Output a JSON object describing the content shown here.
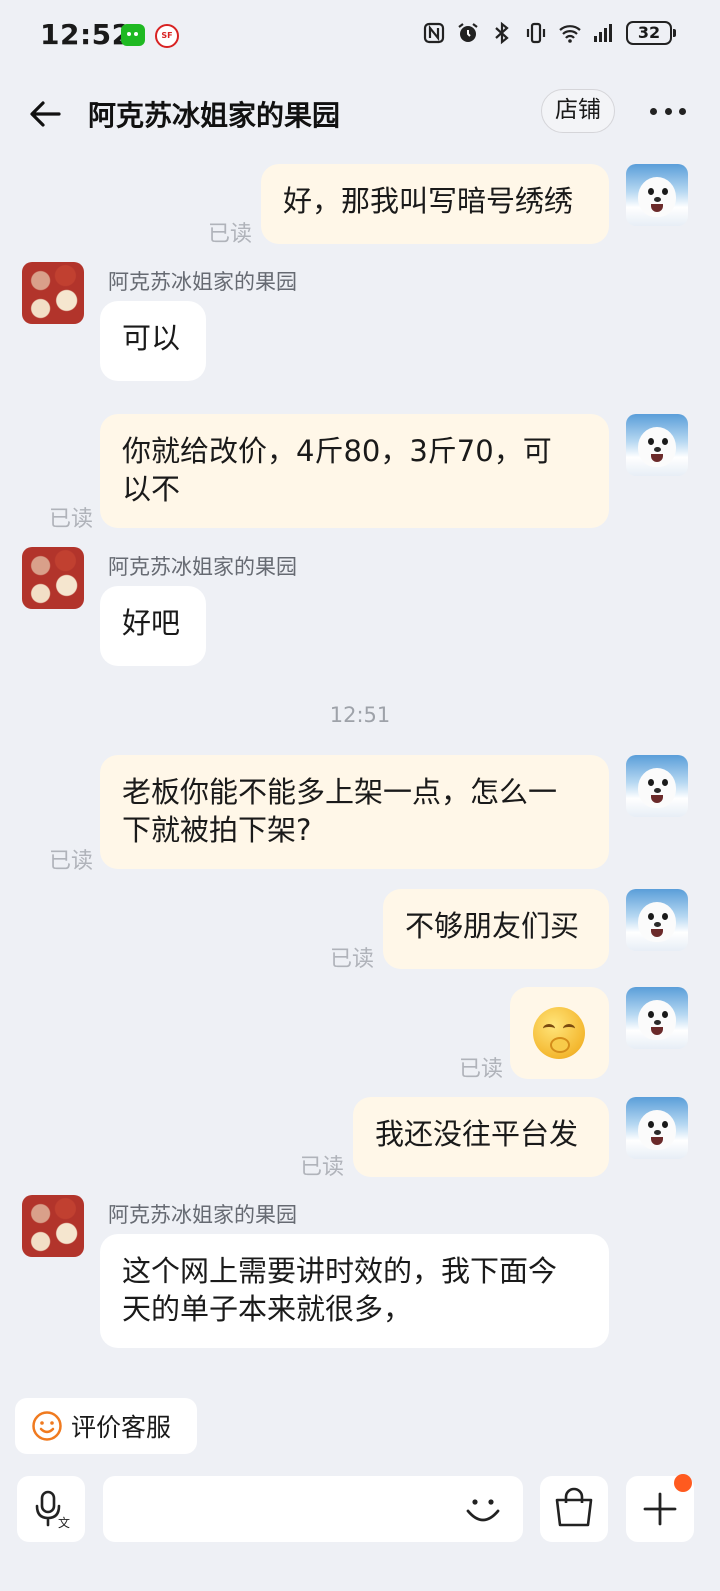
{
  "status_bar": {
    "time": "12:52",
    "battery": "32",
    "sf_label": "SF"
  },
  "header": {
    "title": "阿克苏冰姐家的果园",
    "shop_button": "店铺"
  },
  "shop_name": "阿克苏冰姐家的果园",
  "read_label": "已读",
  "timestamp": "12:51",
  "messages": [
    {
      "text": "好，那我叫写暗号绣绣",
      "direction": "out"
    },
    {
      "text": "可以",
      "direction": "in"
    },
    {
      "text": "你就给改价，4斤80，3斤70，可\n以不",
      "direction": "out"
    },
    {
      "text": "好吧",
      "direction": "in"
    },
    {
      "text": "老板你能不能多上架一点，怎么一\n下就被拍下架?",
      "direction": "out"
    },
    {
      "text": "不够朋友们买",
      "direction": "out"
    },
    {
      "text": "",
      "direction": "out",
      "emoji": "hand-over-mouth-emoji"
    },
    {
      "text": "我还没往平台发",
      "direction": "out"
    },
    {
      "text": "这个网上需要讲时效的，我下面今\n天的单子本来就很多，",
      "direction": "in"
    }
  ],
  "bottom": {
    "rate_button": "评价客服"
  },
  "colors": {
    "outgoing_bubble": "#fff7e8",
    "incoming_bubble": "#ffffff",
    "background": "#eef0f5",
    "badge": "#ff5a1f"
  }
}
